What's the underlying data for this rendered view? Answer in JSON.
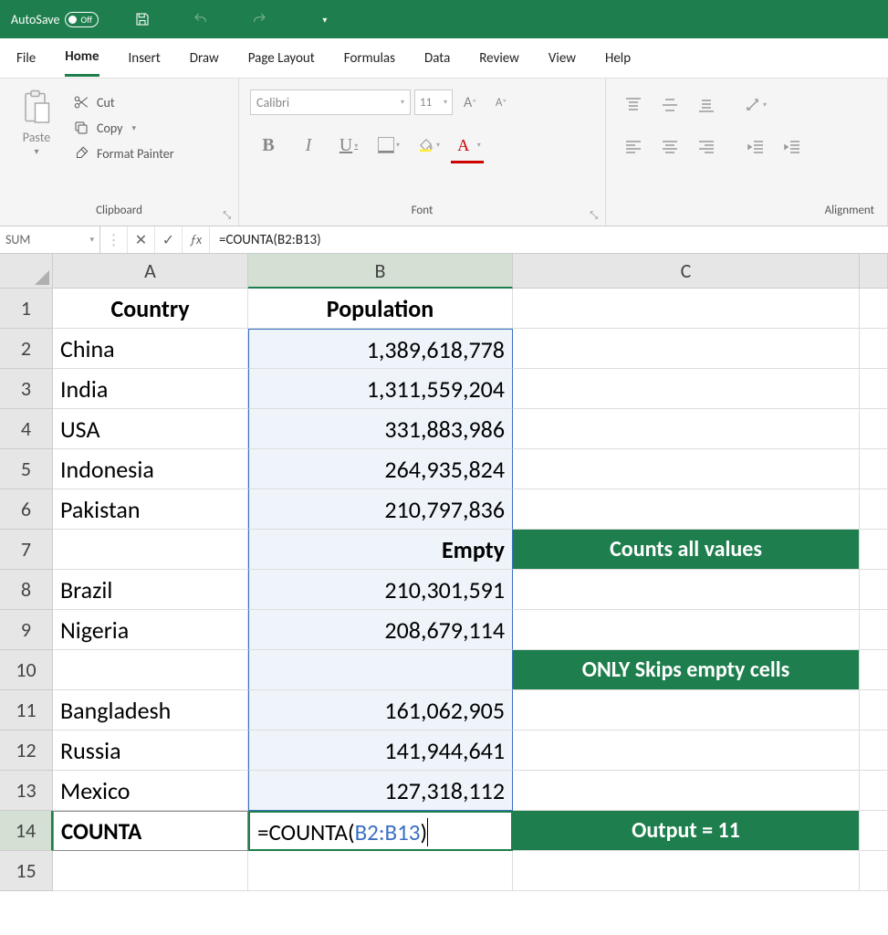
{
  "title_bar": {
    "autosave_label": "AutoSave",
    "autosave_state": "Off"
  },
  "tabs": [
    "File",
    "Home",
    "Insert",
    "Draw",
    "Page Layout",
    "Formulas",
    "Data",
    "Review",
    "View",
    "Help"
  ],
  "active_tab": "Home",
  "clipboard": {
    "paste": "Paste",
    "cut": "Cut",
    "copy": "Copy",
    "format_painter": "Format Painter",
    "group_label": "Clipboard"
  },
  "font": {
    "name": "Calibri",
    "size": "11",
    "group_label": "Font"
  },
  "alignment": {
    "group_label": "Alignment"
  },
  "name_box": "SUM",
  "formula_bar": "=COUNTA(B2:B13)",
  "columns": [
    "A",
    "B",
    "C"
  ],
  "rows": [
    {
      "n": "1",
      "a": "Country",
      "b": "Population",
      "c": ""
    },
    {
      "n": "2",
      "a": "China",
      "b": "1,389,618,778",
      "c": ""
    },
    {
      "n": "3",
      "a": "India",
      "b": "1,311,559,204",
      "c": ""
    },
    {
      "n": "4",
      "a": "USA",
      "b": "331,883,986",
      "c": ""
    },
    {
      "n": "5",
      "a": "Indonesia",
      "b": "264,935,824",
      "c": ""
    },
    {
      "n": "6",
      "a": "Pakistan",
      "b": "210,797,836",
      "c": ""
    },
    {
      "n": "7",
      "a": "",
      "b": "Empty",
      "c": "Counts all values"
    },
    {
      "n": "8",
      "a": "Brazil",
      "b": "210,301,591",
      "c": ""
    },
    {
      "n": "9",
      "a": "Nigeria",
      "b": "208,679,114",
      "c": ""
    },
    {
      "n": "10",
      "a": "",
      "b": "",
      "c": "ONLY Skips empty cells"
    },
    {
      "n": "11",
      "a": "Bangladesh",
      "b": "161,062,905",
      "c": ""
    },
    {
      "n": "12",
      "a": "Russia",
      "b": "141,944,641",
      "c": ""
    },
    {
      "n": "13",
      "a": "Mexico",
      "b": "127,318,112",
      "c": ""
    },
    {
      "n": "14",
      "a": "COUNTA",
      "b_formula_prefix": "=COUNTA(",
      "b_formula_ref": "B2:B13",
      "b_formula_suffix": ")",
      "c": "Output = 11"
    },
    {
      "n": "15",
      "a": "",
      "b": "",
      "c": ""
    }
  ]
}
